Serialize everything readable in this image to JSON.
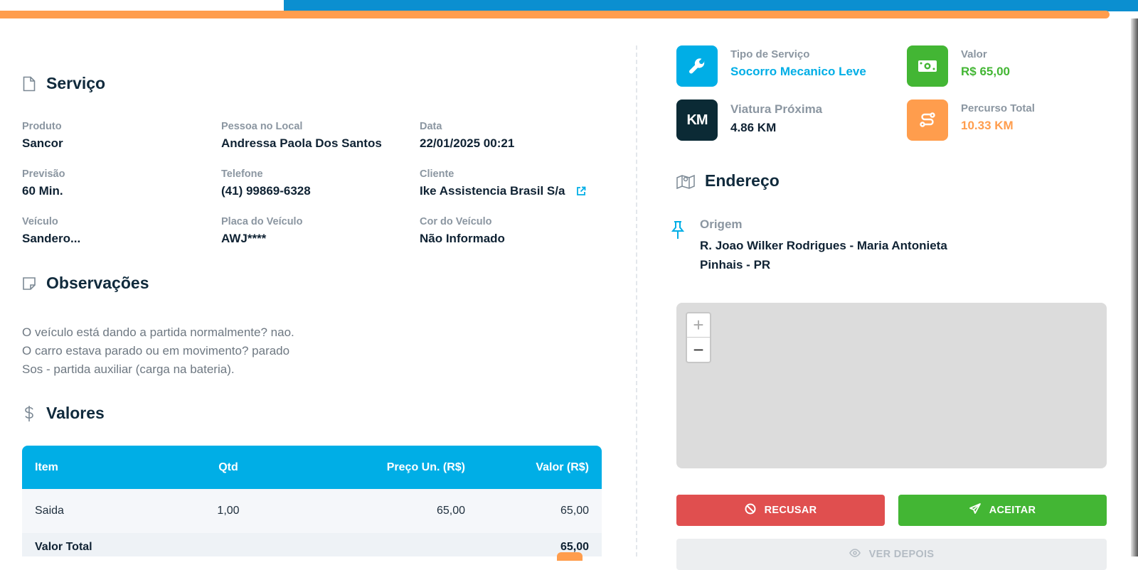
{
  "colors": {
    "accent_blue": "#00aee6",
    "orange": "#ff9d4d",
    "green": "#43b634",
    "red": "#e04f4f",
    "dark": "#0b2a35"
  },
  "servico": {
    "title": "Serviço",
    "fields": [
      {
        "label": "Produto",
        "value": "Sancor"
      },
      {
        "label": "Pessoa no Local",
        "value": "Andressa Paola Dos Santos"
      },
      {
        "label": "Data",
        "value": "22/01/2025 00:21"
      },
      {
        "label": "Previsão",
        "value": "60 Min."
      },
      {
        "label": "Telefone",
        "value": "(41) 99869-6328"
      },
      {
        "label": "Cliente",
        "value": "Ike Assistencia Brasil S/a"
      },
      {
        "label": "Veículo",
        "value": "Sandero..."
      },
      {
        "label": "Placa do Veículo",
        "value": "AWJ****"
      },
      {
        "label": "Cor do Veículo",
        "value": "Não Informado"
      }
    ]
  },
  "observacoes": {
    "title": "Observações",
    "lines": [
      "O veículo está dando a partida normalmente? nao.",
      "O carro estava parado ou em movimento? parado",
      "Sos - partida auxiliar (carga na bateria)."
    ]
  },
  "valores": {
    "title": "Valores",
    "headers": [
      "Item",
      "Qtd",
      "Preço Un. (R$)",
      "Valor (R$)"
    ],
    "rows": [
      [
        "Saida",
        "1,00",
        "65,00",
        "65,00"
      ]
    ],
    "total_label": "Valor Total",
    "total_value": "65,00"
  },
  "cards": [
    {
      "label": "Tipo de Serviço",
      "value": "Socorro Mecanico Leve",
      "icon": "wrench-icon",
      "color": "#00aee6"
    },
    {
      "label": "Valor",
      "value": "R$ 65,00",
      "icon": "money-icon",
      "color": "#43b634"
    },
    {
      "label": "Viatura Próxima",
      "value": "4.86 KM",
      "icon": "km-icon",
      "icon_text": "KM",
      "color": "#0b2a35"
    },
    {
      "label": "Percurso Total",
      "value": "10.33 KM",
      "icon": "route-icon",
      "color": "#ff9d4d"
    }
  ],
  "endereco": {
    "title": "Endereço",
    "origin_label": "Origem",
    "origin_value": "R. Joao Wilker Rodrigues - Maria Antonieta Pinhais - PR"
  },
  "map": {
    "zoom_in": "+",
    "zoom_out": "−"
  },
  "actions": {
    "refuse": "RECUSAR",
    "accept": "ACEITAR",
    "later": "VER DEPOIS"
  }
}
